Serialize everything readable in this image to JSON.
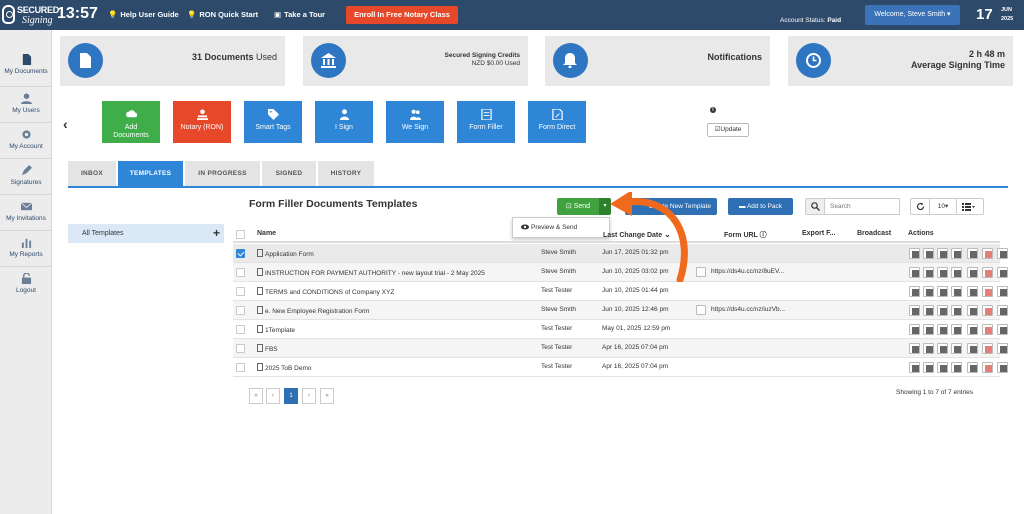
{
  "topbar": {
    "logo_line1": "SECURED",
    "logo_line2": "Signing",
    "clock": "13:57",
    "links": [
      {
        "label": "Help User Guide",
        "icon": "lightbulb-icon"
      },
      {
        "label": "RON Quick Start",
        "icon": "lightbulb-icon"
      },
      {
        "label": "Take a Tour",
        "icon": "tour-icon"
      }
    ],
    "enroll_label": "Enroll In Free Notary Class",
    "account_status_label": "Account Status:",
    "account_status_value": "Paid",
    "welcome": "Welcome,  Steve Smith",
    "date_day": "17",
    "date_month": "JUN",
    "date_year": "2025",
    "colors": {
      "bar": "#2e4a6b",
      "enroll": "#e8482a",
      "welcome": "#3a73b8"
    }
  },
  "sidebar": {
    "items": [
      {
        "label": "My Documents",
        "icon": "document-icon"
      },
      {
        "label": "My Users",
        "icon": "user-icon"
      },
      {
        "label": "My Account",
        "icon": "gear-icon"
      },
      {
        "label": "Signatures",
        "icon": "pen-icon"
      },
      {
        "label": "My Invitations",
        "icon": "envelope-icon"
      },
      {
        "label": "My Reports",
        "icon": "bar-chart-icon"
      },
      {
        "label": "Logout",
        "icon": "lock-icon"
      }
    ]
  },
  "cards": [
    {
      "main": "31 Documents",
      "suffix": "Used",
      "icon": "document-icon"
    },
    {
      "line1": "Secured Signing Credits",
      "line2": "NZD $0.00 Used",
      "icon": "bank-icon"
    },
    {
      "main": "Notifications",
      "icon": "bell-icon"
    },
    {
      "line1": "2 h 48 m",
      "line2": "Average Signing Time",
      "icon": "clock-icon"
    }
  ],
  "actions": [
    {
      "label1": "Add",
      "label2": "Documents",
      "icon": "cloud-upload-icon",
      "color": "#3fae4a"
    },
    {
      "label1": "Notary (RON)",
      "label2": "",
      "icon": "user-stamp-icon",
      "color": "#e8482a"
    },
    {
      "label1": "Smart Tags",
      "label2": "",
      "icon": "tag-icon",
      "color": "#2f86d6"
    },
    {
      "label1": "I Sign",
      "label2": "",
      "icon": "person-icon",
      "color": "#2f86d6"
    },
    {
      "label1": "We Sign",
      "label2": "",
      "icon": "people-icon",
      "color": "#2f86d6"
    },
    {
      "label1": "Form Filler",
      "label2": "",
      "icon": "form-icon",
      "color": "#2f86d6"
    },
    {
      "label1": "Form Direct",
      "label2": "",
      "icon": "form-direct-icon",
      "color": "#2f86d6"
    }
  ],
  "update_label": "Update",
  "tabs": [
    "INBOX",
    "TEMPLATES",
    "IN PROGRESS",
    "SIGNED",
    "HISTORY"
  ],
  "active_tab": "TEMPLATES",
  "left_panel": {
    "all_templates": "All Templates"
  },
  "table": {
    "title": "Form Filler Documents Templates",
    "send_label": "Send",
    "dropdown_item": "Preview & Send",
    "create_label": "Create New Template",
    "add_pack_label": "Add to Pack",
    "search_placeholder": "Search",
    "page_size": "10",
    "headers": [
      "Name",
      "",
      "Last Change Date",
      "Form URL",
      "Export F...",
      "Broadcast",
      "Actions"
    ],
    "rows": [
      {
        "name": "Application Form",
        "owner": "Steve Smith",
        "date": "Jun 17, 2025 01:32 pm",
        "url": "",
        "checked": true
      },
      {
        "name": "INSTRUCTION FOR PAYMENT AUTHORITY - new layout trial - 2 May 2025",
        "owner": "Steve Smith",
        "date": "Jun 10, 2025 03:02 pm",
        "url": "https://ds4u.cc/nz/8uEV...",
        "checked": false
      },
      {
        "name": "TERMS and CONDITIONS of Company XYZ",
        "owner": "Test Tester",
        "date": "Jun 10, 2025 01:44 pm",
        "url": "",
        "checked": false
      },
      {
        "name": "e. New Employee Registration Form",
        "owner": "Steve Smith",
        "date": "Jun 10, 2025 12:46 pm",
        "url": "https://ds4u.cc/nz/iuzVb...",
        "checked": false
      },
      {
        "name": "1Template",
        "owner": "Test Tester",
        "date": "May 01, 2025 12:59 pm",
        "url": "",
        "checked": false
      },
      {
        "name": "FBS",
        "owner": "Test Tester",
        "date": "Apr 16, 2025 07:04 pm",
        "url": "",
        "checked": false
      },
      {
        "name": "2025 ToB Demo",
        "owner": "Test Tester",
        "date": "Apr 16, 2025 07:04 pm",
        "url": "",
        "checked": false
      }
    ],
    "pager": [
      "«",
      "‹",
      "1",
      "›",
      "»"
    ],
    "current_page": "1",
    "showing": "Showing 1 to 7 of 7 entries"
  }
}
